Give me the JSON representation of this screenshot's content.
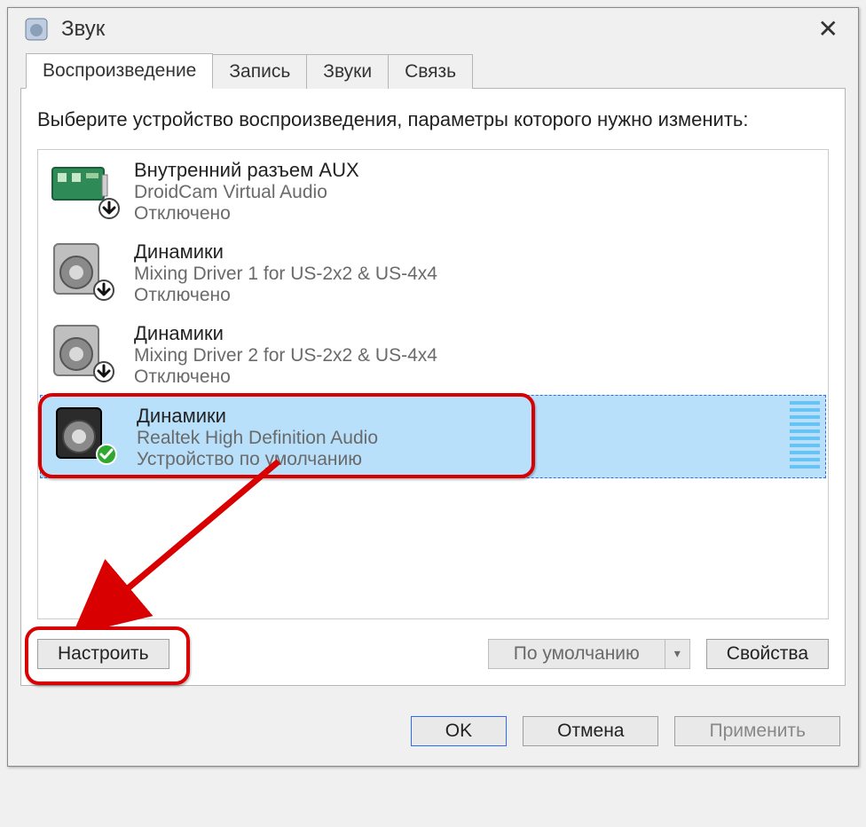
{
  "window": {
    "title": "Звук"
  },
  "tabs": [
    {
      "label": "Воспроизведение",
      "active": true
    },
    {
      "label": "Запись"
    },
    {
      "label": "Звуки"
    },
    {
      "label": "Связь"
    }
  ],
  "instruction": "Выберите устройство воспроизведения, параметры которого нужно изменить:",
  "devices": [
    {
      "name": "Внутренний разъем  AUX",
      "desc": "DroidCam Virtual Audio",
      "status": "Отключено",
      "icon": "card",
      "badge": "down"
    },
    {
      "name": "Динамики",
      "desc": "Mixing Driver 1 for US-2x2 & US-4x4",
      "status": "Отключено",
      "icon": "speaker",
      "badge": "down"
    },
    {
      "name": "Динамики",
      "desc": "Mixing Driver 2 for US-2x2 & US-4x4",
      "status": "Отключено",
      "icon": "speaker",
      "badge": "down"
    },
    {
      "name": "Динамики",
      "desc": "Realtek High Definition Audio",
      "status": "Устройство по умолчанию",
      "icon": "speaker-dark",
      "badge": "check",
      "selected": true
    }
  ],
  "buttons": {
    "configure": "Настроить",
    "default": "По умолчанию",
    "properties": "Свойства",
    "ok": "OK",
    "cancel": "Отмена",
    "apply": "Применить"
  }
}
